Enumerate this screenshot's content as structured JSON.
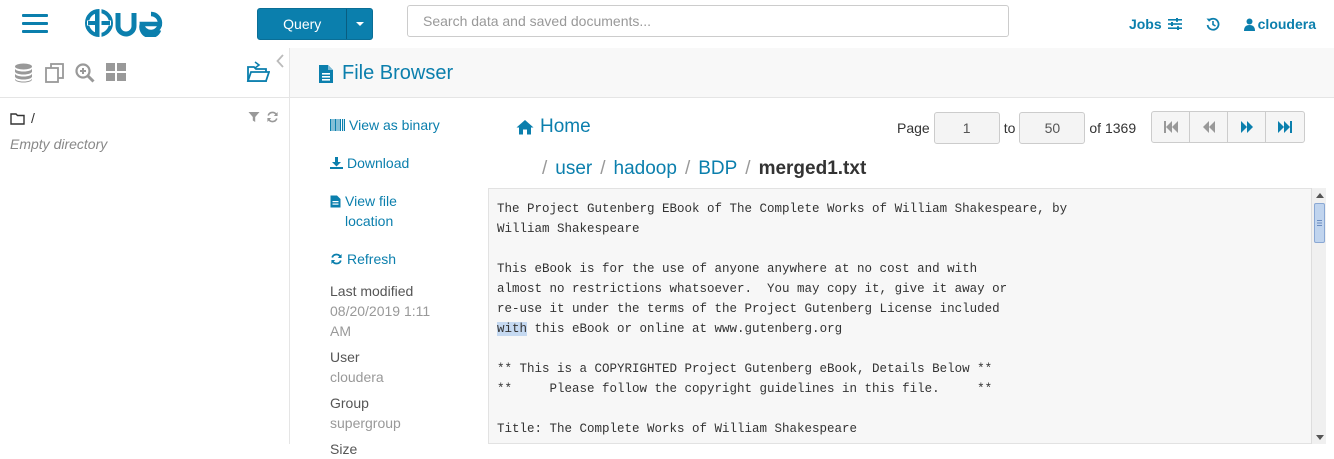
{
  "topbar": {
    "query_label": "Query",
    "search_placeholder": "Search data and saved documents...",
    "jobs_label": "Jobs",
    "user_label": "cloudera"
  },
  "leftpanel": {
    "path": "/",
    "empty_text": "Empty directory"
  },
  "main": {
    "title": "File Browser",
    "actions": {
      "view_binary": "View as binary",
      "download": "Download",
      "view_location": "View file location",
      "refresh": "Refresh"
    },
    "meta": {
      "last_modified_label": "Last modified",
      "last_modified_value": "08/20/2019 1:11 AM",
      "user_label": "User",
      "user_value": "cloudera",
      "group_label": "Group",
      "group_value": "supergroup",
      "size_label": "Size"
    },
    "home_label": "Home",
    "pager": {
      "page_label": "Page",
      "from_value": "1",
      "to_label": "to",
      "to_value": "50",
      "of_label": "of 1369"
    },
    "breadcrumb": [
      "user",
      "hadoop",
      "BDP"
    ],
    "current_file": "merged1.txt",
    "content": {
      "line1": "The Project Gutenberg EBook of The Complete Works of William Shakespeare, by",
      "line2": "William Shakespeare",
      "line3": "",
      "line4": "This eBook is for the use of anyone anywhere at no cost and with",
      "line5": "almost no restrictions whatsoever.  You may copy it, give it away or",
      "line6": "re-use it under the terms of the Project Gutenberg License included",
      "line7_selected": "with",
      "line7_rest": " this eBook or online at www.gutenberg.org",
      "line8": "",
      "line9": "** This is a COPYRIGHTED Project Gutenberg eBook, Details Below **",
      "line10": "**     Please follow the copyright guidelines in this file.     **",
      "line11": "",
      "line12": "Title: The Complete Works of William Shakespeare"
    }
  },
  "colors": {
    "accent": "#0B7FAD",
    "selection": "#c5d9f1"
  }
}
